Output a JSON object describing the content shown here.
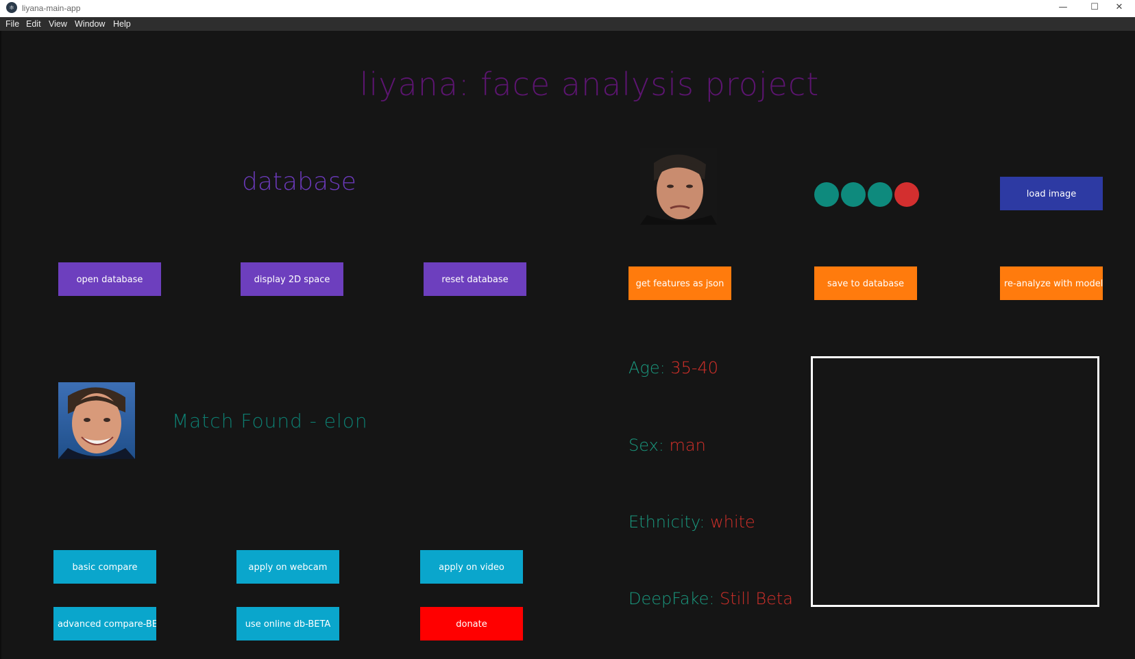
{
  "window": {
    "title": "liyana-main-app",
    "app_icon": "electron-icon",
    "controls": {
      "minimize": "—",
      "maximize": "☐",
      "close": "✕"
    }
  },
  "menu": [
    "File",
    "Edit",
    "View",
    "Window",
    "Help"
  ],
  "app_title": "liyana: face analysis project",
  "database": {
    "title": "database",
    "buttons": [
      "open database",
      "display 2D space",
      "reset database"
    ]
  },
  "match": {
    "text": "Match Found - elon"
  },
  "analysis": {
    "load_image": "load image",
    "status_dots": [
      "#0e8a7d",
      "#0e8a7d",
      "#0e8a7d",
      "#d32f2f"
    ],
    "buttons": [
      "get features as json",
      "save to database",
      "re-analyze with models"
    ],
    "attributes": [
      {
        "label": "Age: ",
        "value": "35-40"
      },
      {
        "label": "Sex: ",
        "value": "man"
      },
      {
        "label": "Ethnicity: ",
        "value": "white"
      },
      {
        "label": "DeepFake: ",
        "value": "Still Beta"
      }
    ]
  },
  "bottom_buttons": {
    "row1": [
      "basic compare",
      "apply on webcam",
      "apply on video"
    ],
    "row2": [
      "advanced compare-BETA",
      "use online db-BETA",
      "donate"
    ]
  },
  "colors": {
    "title": "#5c1570",
    "database_title": "#6a39b8",
    "match_text": "#0d7f72",
    "attr_label": "#1a9a80",
    "attr_value": "#d5302a"
  }
}
